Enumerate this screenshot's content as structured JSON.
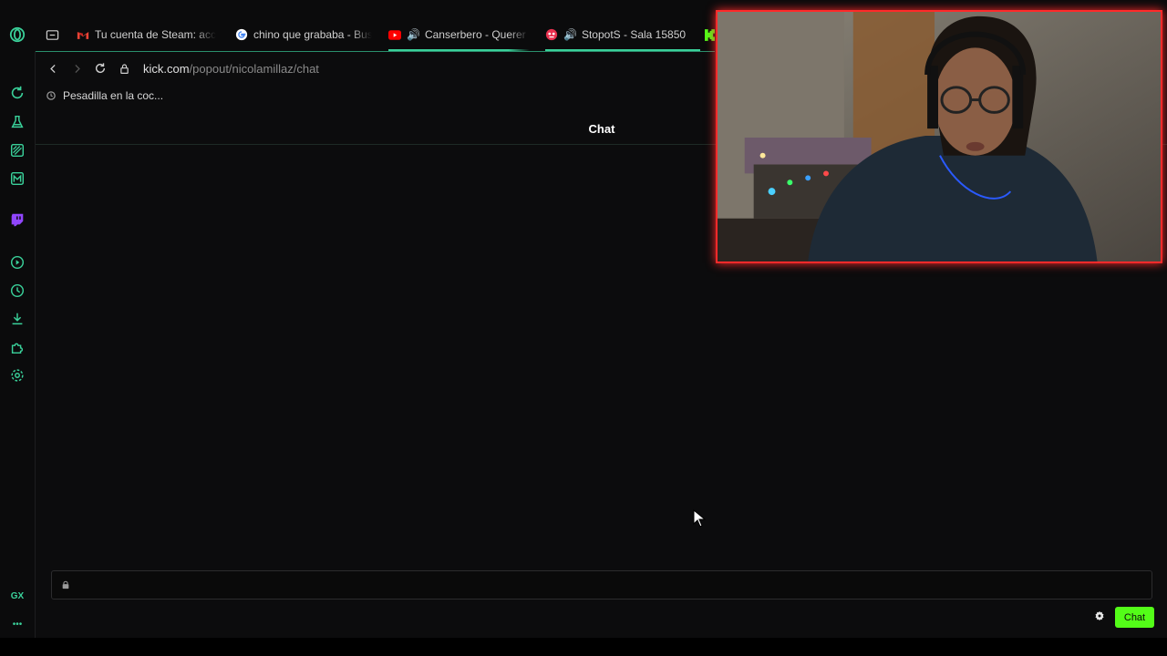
{
  "browser": {
    "tabs": [
      {
        "label": "Tu cuenta de Steam: acc",
        "icon": "gmail-icon",
        "audio": false
      },
      {
        "label": "chino que grababa - Bus",
        "icon": "google-icon",
        "audio": false
      },
      {
        "label": "Canserbero - Querer",
        "icon": "youtube-icon",
        "audio": true
      },
      {
        "label": "StopotS - Sala 15850",
        "icon": "stopots-icon",
        "audio": true
      }
    ],
    "address": {
      "domain": "kick.com",
      "path": "/popout/nicolamillaz/chat"
    },
    "page_title": "Pesadilla en la coc..."
  },
  "chat": {
    "header": "Chat",
    "input_placeholder": "",
    "send_label": "Chat"
  },
  "sidebar": {
    "gx_label": "GX",
    "more_label": "•••"
  },
  "colors": {
    "accent": "#3ad19a",
    "kick_green": "#53fc18",
    "webcam_border": "#ff2a2a"
  }
}
